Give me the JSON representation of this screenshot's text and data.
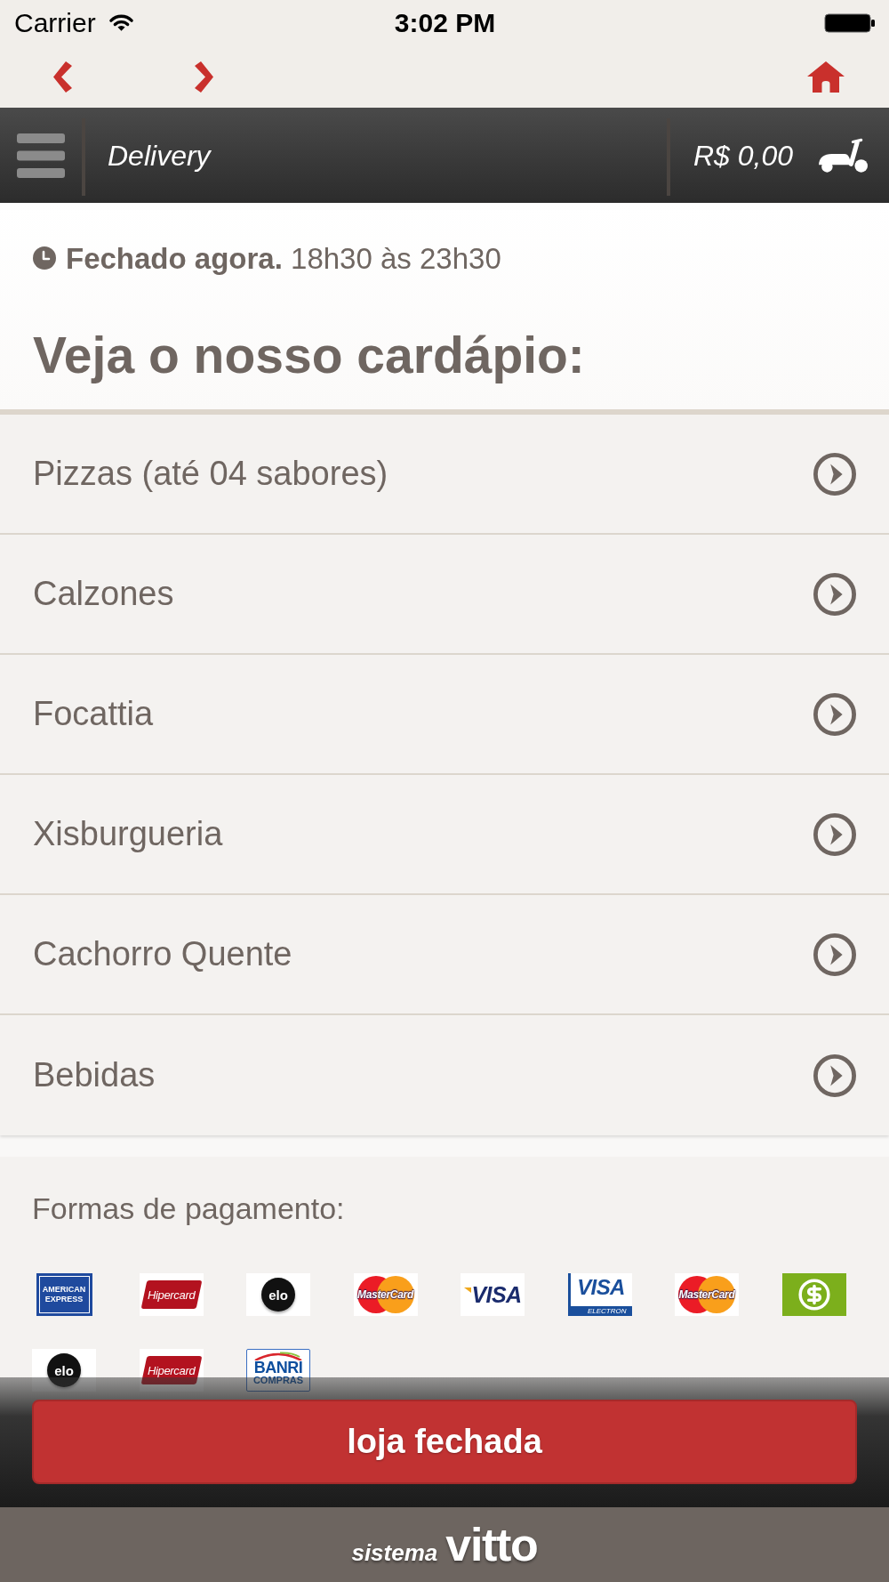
{
  "status_bar": {
    "carrier": "Carrier",
    "time": "3:02 PM"
  },
  "header": {
    "title": "Delivery",
    "cart_total": "R$ 0,00"
  },
  "hours": {
    "text": "**Fechado agora.** 18h30 às 23h30"
  },
  "menu": {
    "title": "Veja o nosso cardápio:",
    "categories": [
      {
        "label": "Pizzas (até 04 sabores)"
      },
      {
        "label": "Calzones"
      },
      {
        "label": "Focattia"
      },
      {
        "label": "Xisburgueria"
      },
      {
        "label": "Cachorro Quente"
      },
      {
        "label": "Bebidas"
      }
    ]
  },
  "payment": {
    "title": "Formas de pagamento:",
    "methods": [
      {
        "kind": "amex",
        "label": "AMERICAN EXPRESS"
      },
      {
        "kind": "hipercard",
        "label": "Hipercard"
      },
      {
        "kind": "elo",
        "label": "elo"
      },
      {
        "kind": "mastercard",
        "label": "MasterCard"
      },
      {
        "kind": "visa",
        "label": "VISA"
      },
      {
        "kind": "visa_electron",
        "label": "VISA",
        "sublabel": "ELECTRON"
      },
      {
        "kind": "mastercard",
        "label": "MasterCard"
      },
      {
        "kind": "cash"
      },
      {
        "kind": "elo",
        "label": "elo"
      },
      {
        "kind": "hipercard",
        "label": "Hipercard"
      },
      {
        "kind": "banricompras",
        "label": "BANRI",
        "sublabel": "COMPRAS"
      }
    ]
  },
  "store_button": {
    "label": "loja fechada"
  },
  "footer": {
    "brand_prefix": "sistema",
    "brand": "vitto"
  }
}
